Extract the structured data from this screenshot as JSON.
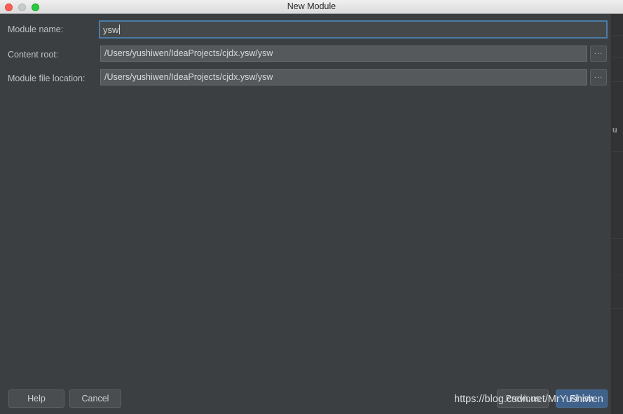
{
  "window": {
    "title": "New Module",
    "traffic_lights": [
      {
        "name": "close",
        "color": "#ff5f57"
      },
      {
        "name": "minimize",
        "color": "#c9cacb"
      },
      {
        "name": "maximize",
        "color": "#28c840"
      }
    ]
  },
  "theme": {
    "body_bg": "#3c3f41",
    "titlebar_bg": "#ececec",
    "field_bg": "#55595b",
    "focus_border": "#4b7ba8",
    "accent_button": "#3f628c",
    "text": "#bfc1c2"
  },
  "form": {
    "rows": [
      {
        "label": "Module name:",
        "value": "ysw",
        "placeholder": "",
        "type": "text",
        "focused": true,
        "has_browse": false,
        "browse_label": ""
      },
      {
        "label": "Content root:",
        "value": "/Users/yushiwen/IdeaProjects/cjdx.ysw/ysw",
        "placeholder": "",
        "type": "path",
        "focused": false,
        "has_browse": true,
        "browse_label": "..."
      },
      {
        "label": "Module file location:",
        "value": "/Users/yushiwen/IdeaProjects/cjdx.ysw/ysw",
        "placeholder": "",
        "type": "path",
        "focused": false,
        "has_browse": true,
        "browse_label": "..."
      }
    ]
  },
  "footer": {
    "help_label": "Help",
    "cancel_label": "Cancel",
    "previous_label": "Previous",
    "finish_label": "Finish"
  },
  "overlay": {
    "watermark": "https://blog.csdn.net/MrYushiwen"
  },
  "background_window": {
    "glyph": "u"
  }
}
